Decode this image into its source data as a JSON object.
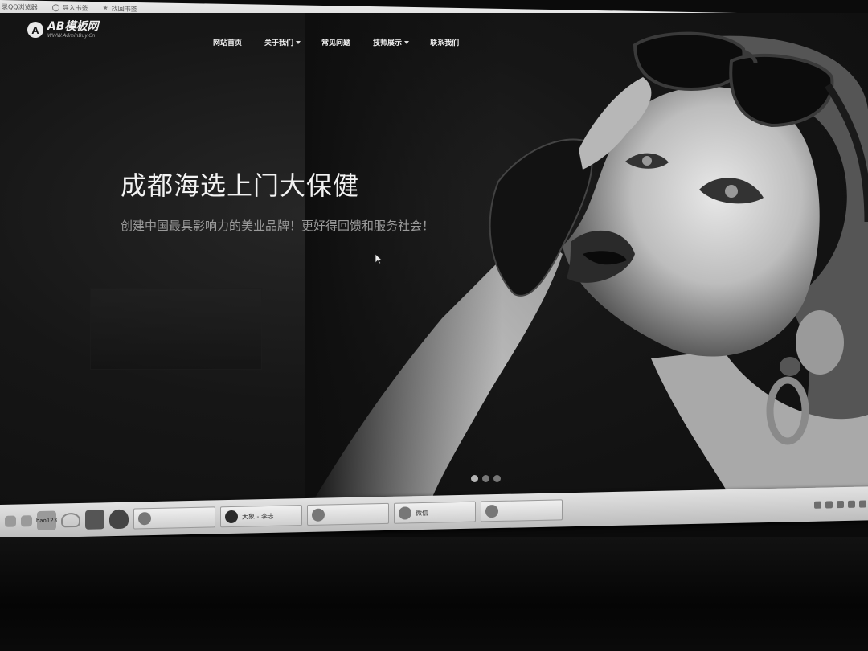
{
  "browser": {
    "bookmarks": [
      {
        "label": "录QQ浏览器",
        "icon": "qq-browser-icon"
      },
      {
        "label": "导入书签",
        "icon": "import-icon"
      },
      {
        "label": "找回书签",
        "icon": "star-icon"
      }
    ]
  },
  "site": {
    "logo": {
      "name": "AB模板网",
      "url": "WWW.AdminBuy.Cn",
      "mark": "A"
    },
    "nav": [
      {
        "label": "网站首页",
        "dropdown": false
      },
      {
        "label": "关于我们",
        "dropdown": true
      },
      {
        "label": "常见问题",
        "dropdown": false
      },
      {
        "label": "技师展示",
        "dropdown": true
      },
      {
        "label": "联系我们",
        "dropdown": false
      }
    ],
    "hero": {
      "title": "成都海选上门大保健",
      "subtitle": "创建中国最具影响力的美业品牌！更好得回馈和服务社会！"
    },
    "slider": {
      "count": 3,
      "active": 1
    }
  },
  "taskbar": {
    "pinned": [
      {
        "icon": "show-desktop-icon"
      },
      {
        "icon": "hao123-icon",
        "label": "hao123"
      },
      {
        "icon": "cloud-icon"
      },
      {
        "icon": "avatar-icon"
      },
      {
        "icon": "shield-icon"
      }
    ],
    "windows": [
      {
        "label": "",
        "icon": "qq-icon"
      },
      {
        "label": "大象 - 李志",
        "icon": "music-player-icon"
      },
      {
        "label": "",
        "icon": "ie-browser-icon"
      },
      {
        "label": "微信",
        "icon": "wechat-icon"
      },
      {
        "label": "",
        "icon": "qq-official-icon"
      }
    ]
  },
  "colors": {
    "background": "#0e0e0e",
    "nav_text": "#f0f0f0",
    "subtitle": "#9a9a9a",
    "taskbar": "#d0d0d0"
  }
}
